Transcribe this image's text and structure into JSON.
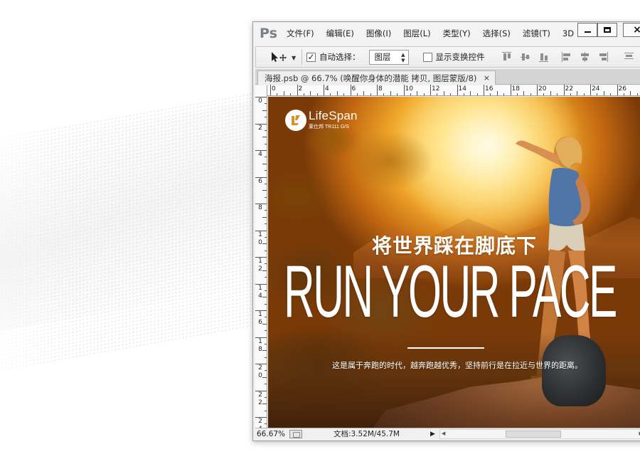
{
  "app": {
    "logo": "Ps",
    "menu": [
      "文件(F)",
      "编辑(E)",
      "图像(I)",
      "图层(L)",
      "类型(Y)",
      "选择(S)",
      "滤镜(T)",
      "3D"
    ],
    "window_controls": {
      "close_glyph": "×"
    }
  },
  "options_bar": {
    "auto_select_label": "自动选择：",
    "auto_select_checked": true,
    "auto_select_target": "图层",
    "show_transform_label": "显示变换控件",
    "show_transform_checked": false
  },
  "document_tab": {
    "title": "海报.psb @ 66.7% (唤醒你身体的潜能 拷贝, 图层蒙版/8)",
    "close_glyph": "×"
  },
  "rulers": {
    "horizontal": [
      "0",
      "2",
      "4",
      "6",
      "8",
      "10",
      "12",
      "14",
      "16",
      "18",
      "20",
      "22",
      "24",
      "26"
    ],
    "vertical": [
      "0",
      "2",
      "4",
      "6",
      "8",
      "10",
      "12",
      "14",
      "16",
      "18",
      "20",
      "22",
      "24"
    ]
  },
  "canvas": {
    "logo_name": "LifeSpan",
    "logo_subtitle": "莱仕邦 TR111 G/S",
    "headline_cn": "将世界踩在脚底下",
    "headline_en": "RUN YOUR PACE",
    "subline": "这是属于奔跑的时代，越奔跑越优秀，坚持前行是在拉近与世界的距离。"
  },
  "status_bar": {
    "zoom": "66.67%",
    "doc_info": "文档:3.52M/45.7M"
  },
  "colors": {
    "sky_light": "#fff3c4",
    "sun_orange": "#f0a72a",
    "shadow_brown": "#7a3a08"
  }
}
